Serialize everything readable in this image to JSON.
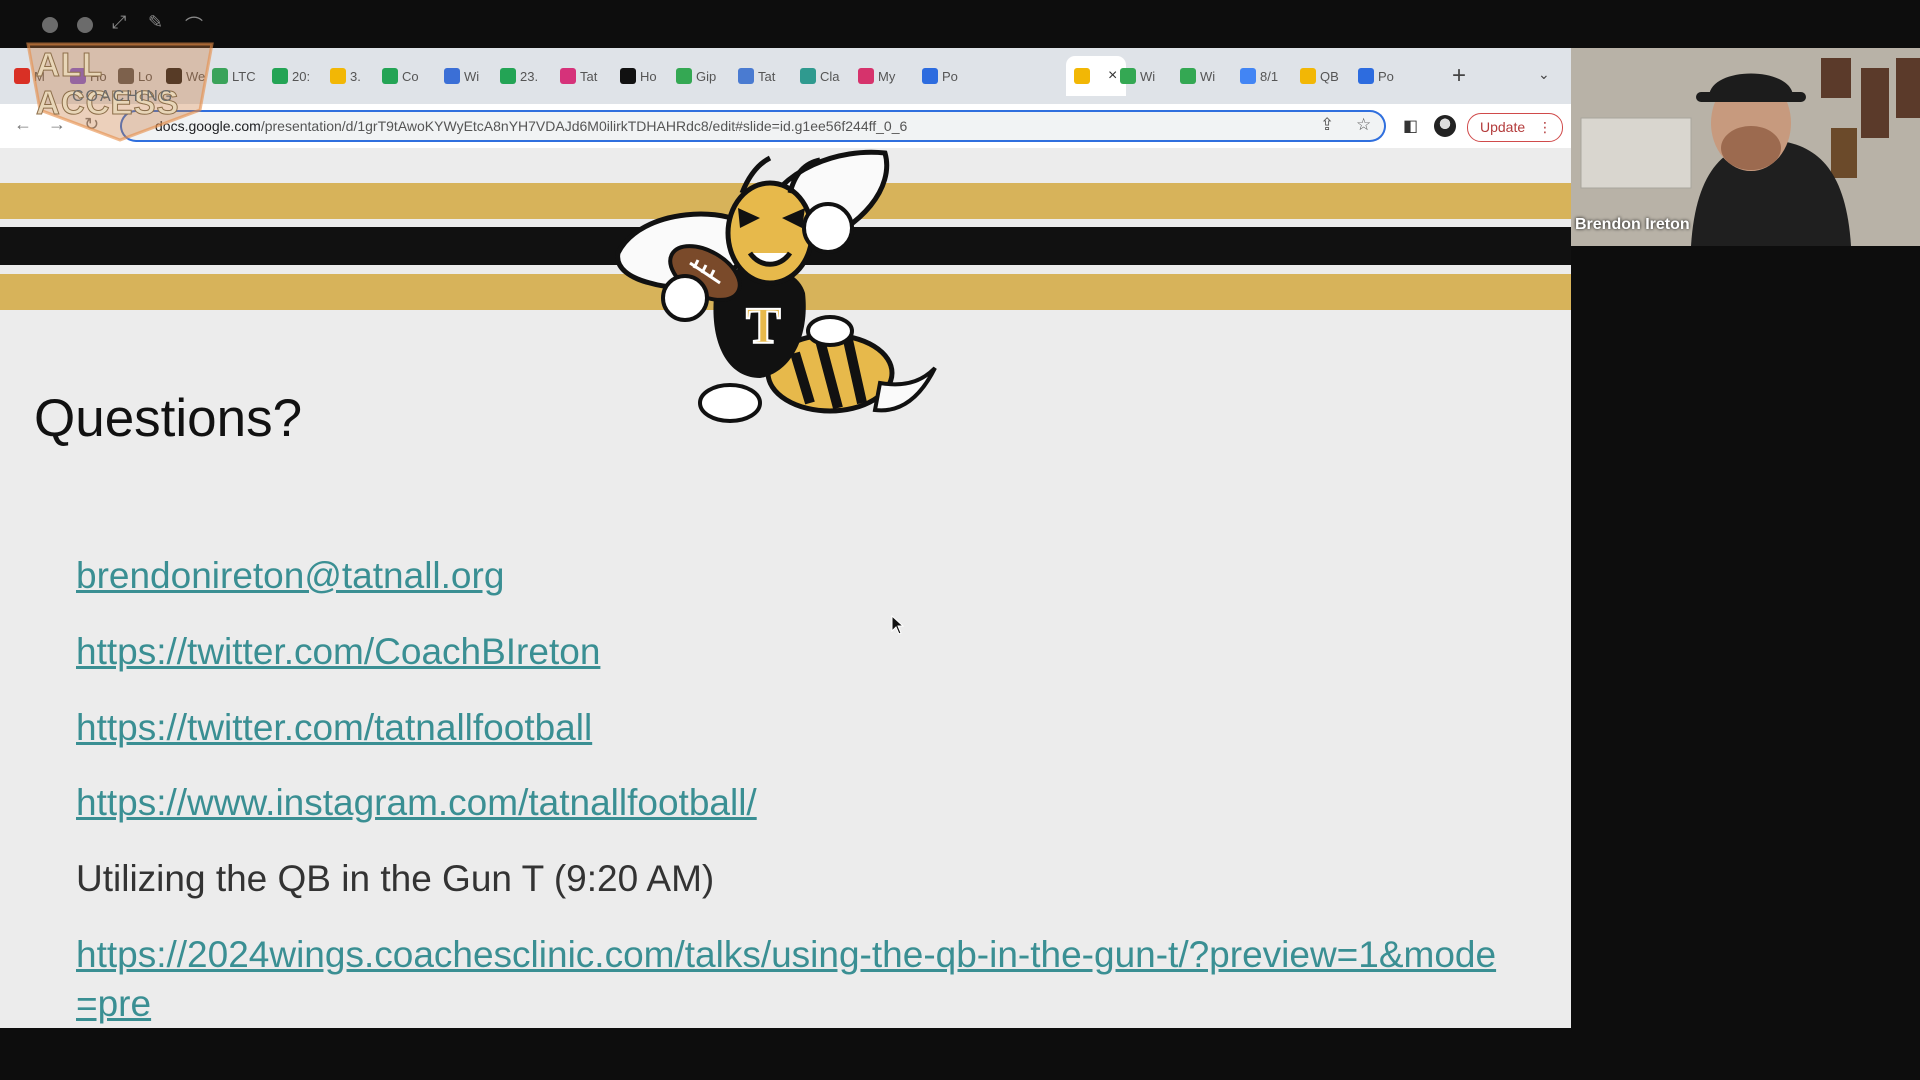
{
  "window": {
    "mac_glyphs": [
      "⤢",
      "✎",
      "⌒"
    ]
  },
  "tabs": [
    {
      "label": "M",
      "color": "#d93025"
    },
    {
      "label": "Ho",
      "color": "#7b5cd6"
    },
    {
      "label": "Lo",
      "color": "#555555"
    },
    {
      "label": "We",
      "color": "#1b1b1b"
    },
    {
      "label": "LTC",
      "color": "#3aa35a"
    },
    {
      "label": "20:",
      "color": "#23a455"
    },
    {
      "label": "3.",
      "color": "#f2b705"
    },
    {
      "label": "Co",
      "color": "#23a455"
    },
    {
      "label": "Wi",
      "color": "#3b6fd6"
    },
    {
      "label": "23.",
      "color": "#23a455"
    },
    {
      "label": "Tat",
      "color": "#d6327a"
    },
    {
      "label": "Ho",
      "color": "#111111"
    },
    {
      "label": "Gip",
      "color": "#34a853"
    },
    {
      "label": "Tat",
      "color": "#4a7bd1"
    },
    {
      "label": "Cla",
      "color": "#2f9a8f"
    },
    {
      "label": "My",
      "color": "#d6336c"
    },
    {
      "label": "Po",
      "color": "#2d6cdf"
    },
    {
      "label": "",
      "color": "#f2b705"
    },
    {
      "label": "Wi",
      "color": "#34a853"
    },
    {
      "label": "Wi",
      "color": "#34a853"
    },
    {
      "label": "8/1",
      "color": "#4285f4"
    },
    {
      "label": "QB",
      "color": "#f2b705"
    },
    {
      "label": "Po",
      "color": "#2d6cdf"
    }
  ],
  "tab_close_icon": "×",
  "new_tab_label": "+",
  "tab_menu_glyph": "⌄",
  "toolbar": {
    "back": "←",
    "forward": "→",
    "reload": "↻",
    "url_host": "docs.google.com",
    "url_path": "/presentation/d/1grT9tAwoKYWyEtcA8nYH7VDAJd6M0ilirkTDHAHRdc8/edit#slide=id.g1ee56f244ff_0_6",
    "update_label": "Update",
    "menu_dots": "⋮"
  },
  "slide": {
    "title": "Questions?",
    "email": "brendonireton@tatnall.org",
    "link_twitter_coach": "https://twitter.com/CoachBIreton",
    "link_twitter_team": "https://twitter.com/tatnallfootball",
    "link_instagram": "https://www.instagram.com/tatnallfootball/",
    "session_text": "Utilizing the QB in the Gun T (9:20 AM)",
    "link_clinic": "https://2024wings.coachesclinic.com/talks/using-the-qb-in-the-gun-t/?preview=1&mode=pre",
    "mascot_letter": "T"
  },
  "video": {
    "participant_name": "Brendon Ireton"
  },
  "watermark": {
    "title": "ALL ACCESS",
    "subtitle": "COACHING"
  },
  "colors": {
    "gold": "#d7b35a",
    "link": "#3a8f93",
    "omnibox_focus": "#2f6fde"
  }
}
